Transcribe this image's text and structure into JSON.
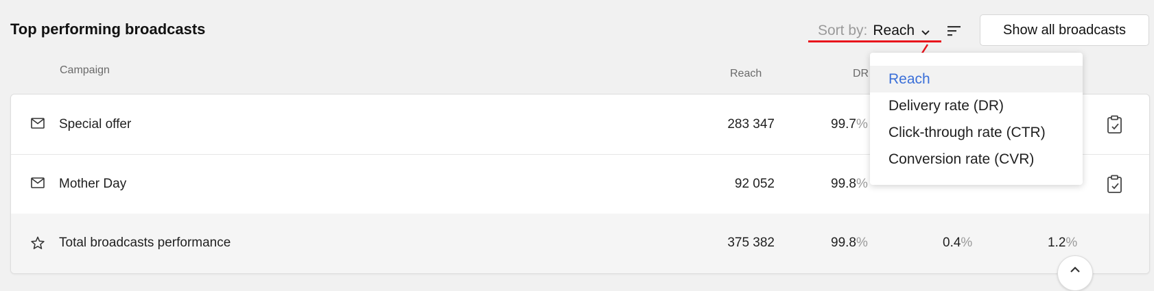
{
  "header": {
    "title": "Top performing broadcasts",
    "sort_label": "Sort by:",
    "sort_value": "Reach",
    "show_all_label": "Show all broadcasts"
  },
  "columns": {
    "campaign": "Campaign",
    "reach": "Reach",
    "dr": "DR"
  },
  "rows": [
    {
      "name": "Special offer",
      "icon": "mail-icon",
      "reach": "283 347",
      "dr": "99.7"
    },
    {
      "name": "Mother Day",
      "icon": "mail-icon",
      "reach": "92 052",
      "dr": "99.8"
    }
  ],
  "total": {
    "name": "Total broadcasts performance",
    "icon": "star-icon",
    "reach": "375 382",
    "dr": "99.8",
    "ctr": "0.4",
    "cvr": "1.2"
  },
  "percent_sign": "%",
  "sort_menu": {
    "items": [
      "Reach",
      "Delivery rate (DR)",
      "Click-through rate (CTR)",
      "Conversion rate (CVR)"
    ],
    "selected": "Reach"
  },
  "colors": {
    "accent": "#3a6fd8",
    "annotation": "#e8141c"
  }
}
